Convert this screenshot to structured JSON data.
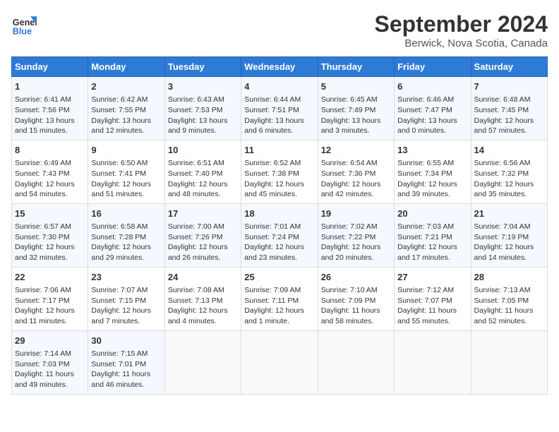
{
  "header": {
    "logo_line1": "General",
    "logo_line2": "Blue",
    "title": "September 2024",
    "subtitle": "Berwick, Nova Scotia, Canada"
  },
  "columns": [
    "Sunday",
    "Monday",
    "Tuesday",
    "Wednesday",
    "Thursday",
    "Friday",
    "Saturday"
  ],
  "weeks": [
    [
      {
        "day": "1",
        "lines": [
          "Sunrise: 6:41 AM",
          "Sunset: 7:56 PM",
          "Daylight: 13 hours",
          "and 15 minutes."
        ]
      },
      {
        "day": "2",
        "lines": [
          "Sunrise: 6:42 AM",
          "Sunset: 7:55 PM",
          "Daylight: 13 hours",
          "and 12 minutes."
        ]
      },
      {
        "day": "3",
        "lines": [
          "Sunrise: 6:43 AM",
          "Sunset: 7:53 PM",
          "Daylight: 13 hours",
          "and 9 minutes."
        ]
      },
      {
        "day": "4",
        "lines": [
          "Sunrise: 6:44 AM",
          "Sunset: 7:51 PM",
          "Daylight: 13 hours",
          "and 6 minutes."
        ]
      },
      {
        "day": "5",
        "lines": [
          "Sunrise: 6:45 AM",
          "Sunset: 7:49 PM",
          "Daylight: 13 hours",
          "and 3 minutes."
        ]
      },
      {
        "day": "6",
        "lines": [
          "Sunrise: 6:46 AM",
          "Sunset: 7:47 PM",
          "Daylight: 13 hours",
          "and 0 minutes."
        ]
      },
      {
        "day": "7",
        "lines": [
          "Sunrise: 6:48 AM",
          "Sunset: 7:45 PM",
          "Daylight: 12 hours",
          "and 57 minutes."
        ]
      }
    ],
    [
      {
        "day": "8",
        "lines": [
          "Sunrise: 6:49 AM",
          "Sunset: 7:43 PM",
          "Daylight: 12 hours",
          "and 54 minutes."
        ]
      },
      {
        "day": "9",
        "lines": [
          "Sunrise: 6:50 AM",
          "Sunset: 7:41 PM",
          "Daylight: 12 hours",
          "and 51 minutes."
        ]
      },
      {
        "day": "10",
        "lines": [
          "Sunrise: 6:51 AM",
          "Sunset: 7:40 PM",
          "Daylight: 12 hours",
          "and 48 minutes."
        ]
      },
      {
        "day": "11",
        "lines": [
          "Sunrise: 6:52 AM",
          "Sunset: 7:38 PM",
          "Daylight: 12 hours",
          "and 45 minutes."
        ]
      },
      {
        "day": "12",
        "lines": [
          "Sunrise: 6:54 AM",
          "Sunset: 7:36 PM",
          "Daylight: 12 hours",
          "and 42 minutes."
        ]
      },
      {
        "day": "13",
        "lines": [
          "Sunrise: 6:55 AM",
          "Sunset: 7:34 PM",
          "Daylight: 12 hours",
          "and 39 minutes."
        ]
      },
      {
        "day": "14",
        "lines": [
          "Sunrise: 6:56 AM",
          "Sunset: 7:32 PM",
          "Daylight: 12 hours",
          "and 35 minutes."
        ]
      }
    ],
    [
      {
        "day": "15",
        "lines": [
          "Sunrise: 6:57 AM",
          "Sunset: 7:30 PM",
          "Daylight: 12 hours",
          "and 32 minutes."
        ]
      },
      {
        "day": "16",
        "lines": [
          "Sunrise: 6:58 AM",
          "Sunset: 7:28 PM",
          "Daylight: 12 hours",
          "and 29 minutes."
        ]
      },
      {
        "day": "17",
        "lines": [
          "Sunrise: 7:00 AM",
          "Sunset: 7:26 PM",
          "Daylight: 12 hours",
          "and 26 minutes."
        ]
      },
      {
        "day": "18",
        "lines": [
          "Sunrise: 7:01 AM",
          "Sunset: 7:24 PM",
          "Daylight: 12 hours",
          "and 23 minutes."
        ]
      },
      {
        "day": "19",
        "lines": [
          "Sunrise: 7:02 AM",
          "Sunset: 7:22 PM",
          "Daylight: 12 hours",
          "and 20 minutes."
        ]
      },
      {
        "day": "20",
        "lines": [
          "Sunrise: 7:03 AM",
          "Sunset: 7:21 PM",
          "Daylight: 12 hours",
          "and 17 minutes."
        ]
      },
      {
        "day": "21",
        "lines": [
          "Sunrise: 7:04 AM",
          "Sunset: 7:19 PM",
          "Daylight: 12 hours",
          "and 14 minutes."
        ]
      }
    ],
    [
      {
        "day": "22",
        "lines": [
          "Sunrise: 7:06 AM",
          "Sunset: 7:17 PM",
          "Daylight: 12 hours",
          "and 11 minutes."
        ]
      },
      {
        "day": "23",
        "lines": [
          "Sunrise: 7:07 AM",
          "Sunset: 7:15 PM",
          "Daylight: 12 hours",
          "and 7 minutes."
        ]
      },
      {
        "day": "24",
        "lines": [
          "Sunrise: 7:08 AM",
          "Sunset: 7:13 PM",
          "Daylight: 12 hours",
          "and 4 minutes."
        ]
      },
      {
        "day": "25",
        "lines": [
          "Sunrise: 7:09 AM",
          "Sunset: 7:11 PM",
          "Daylight: 12 hours",
          "and 1 minute."
        ]
      },
      {
        "day": "26",
        "lines": [
          "Sunrise: 7:10 AM",
          "Sunset: 7:09 PM",
          "Daylight: 11 hours",
          "and 58 minutes."
        ]
      },
      {
        "day": "27",
        "lines": [
          "Sunrise: 7:12 AM",
          "Sunset: 7:07 PM",
          "Daylight: 11 hours",
          "and 55 minutes."
        ]
      },
      {
        "day": "28",
        "lines": [
          "Sunrise: 7:13 AM",
          "Sunset: 7:05 PM",
          "Daylight: 11 hours",
          "and 52 minutes."
        ]
      }
    ],
    [
      {
        "day": "29",
        "lines": [
          "Sunrise: 7:14 AM",
          "Sunset: 7:03 PM",
          "Daylight: 11 hours",
          "and 49 minutes."
        ]
      },
      {
        "day": "30",
        "lines": [
          "Sunrise: 7:15 AM",
          "Sunset: 7:01 PM",
          "Daylight: 11 hours",
          "and 46 minutes."
        ]
      },
      {
        "day": "",
        "lines": []
      },
      {
        "day": "",
        "lines": []
      },
      {
        "day": "",
        "lines": []
      },
      {
        "day": "",
        "lines": []
      },
      {
        "day": "",
        "lines": []
      }
    ]
  ]
}
